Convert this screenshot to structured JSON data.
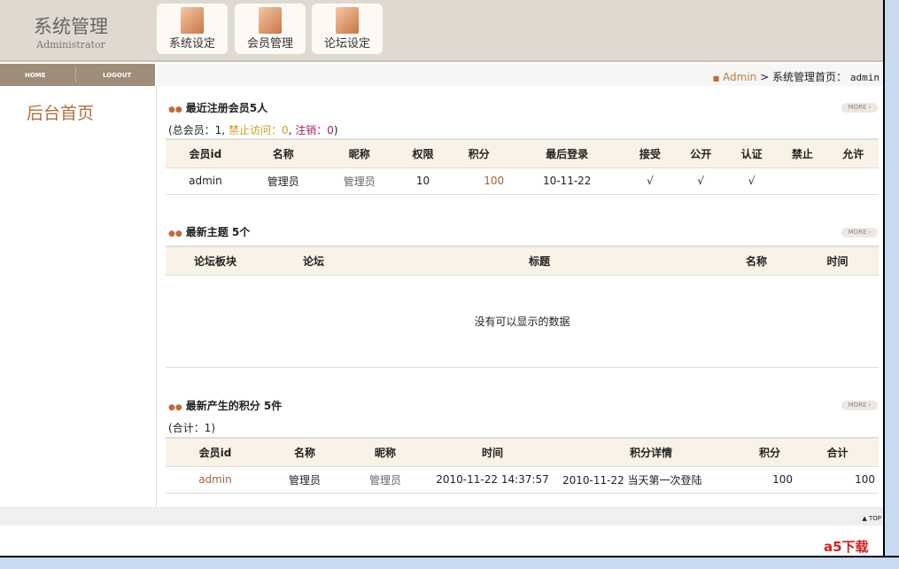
{
  "header": {
    "title": "系统管理",
    "subtitle": "Administrator",
    "buttons": [
      "系统设定",
      "会员管理",
      "论坛设定"
    ]
  },
  "nav": {
    "home": "HOME",
    "logout": "LOGOUT"
  },
  "sidebar": {
    "heading": "后台首页"
  },
  "breadcrumb": {
    "link": "Admin",
    "sep": ">",
    "page": "系统管理首页",
    "colon": "：",
    "user": "admin"
  },
  "more": "MORE ›",
  "members": {
    "title": "最近注册会员5人",
    "summary_a": "(总会员：1, ",
    "summary_b": "禁止访问：0",
    "summary_c": ", ",
    "summary_d": "注销：0",
    "summary_e": ")",
    "headers": [
      "会员id",
      "名称",
      "昵称",
      "权限",
      "积分",
      "最后登录",
      "接受",
      "公开",
      "认证",
      "禁止",
      "允许"
    ],
    "rows": [
      [
        "admin",
        "管理员",
        "管理员",
        "10",
        "100",
        "10-11-22",
        "√",
        "√",
        "√",
        "",
        ""
      ]
    ]
  },
  "topics": {
    "title": "最新主题 5个",
    "headers": [
      "论坛板块",
      "论坛",
      "标题",
      "名称",
      "时间"
    ],
    "empty": "没有可以显示的数据"
  },
  "points": {
    "title": "最新产生的积分 5件",
    "summary": "(合计：1)",
    "headers": [
      "会员id",
      "名称",
      "昵称",
      "时间",
      "积分详情",
      "积分",
      "合计"
    ],
    "rows": [
      [
        "admin",
        "管理员",
        "管理员",
        "2010-11-22 14:37:57",
        "2010-11-22 当天第一次登陆",
        "100",
        "100"
      ]
    ]
  },
  "footer": {
    "top": "▲ TOP"
  },
  "watermark": "a5下载"
}
